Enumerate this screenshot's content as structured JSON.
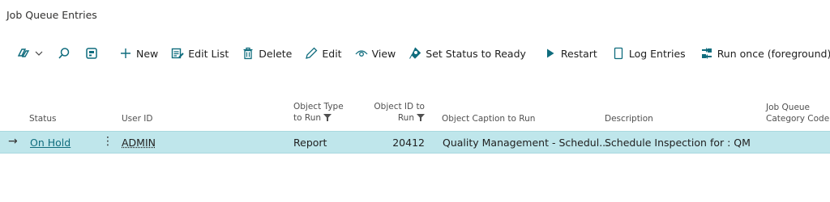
{
  "page": {
    "title": "Job Queue Entries"
  },
  "actions": {
    "new": "New",
    "edit_list": "Edit List",
    "delete": "Delete",
    "edit": "Edit",
    "view": "View",
    "set_status_ready": "Set Status to Ready",
    "restart": "Restart",
    "log_entries": "Log Entries",
    "run_once": "Run once (foreground)"
  },
  "columns": {
    "status": "Status",
    "user_id": "User ID",
    "object_type_l1": "Object Type",
    "object_type_l2": "to Run",
    "object_id_l1": "Object ID to",
    "object_id_l2": "Run",
    "caption": "Object Caption to Run",
    "description": "Description",
    "category_l1": "Job Queue",
    "category_l2": "Category Code"
  },
  "rows": [
    {
      "status": "On Hold",
      "user_id": "ADMIN",
      "object_type": "Report",
      "object_id": "20412",
      "caption": "Quality Management - Schedul...",
      "description": "Schedule Inspection for : QM",
      "category": ""
    }
  ],
  "colors": {
    "accent": "#0f6c7d",
    "selected_row": "#bfe6eb"
  }
}
